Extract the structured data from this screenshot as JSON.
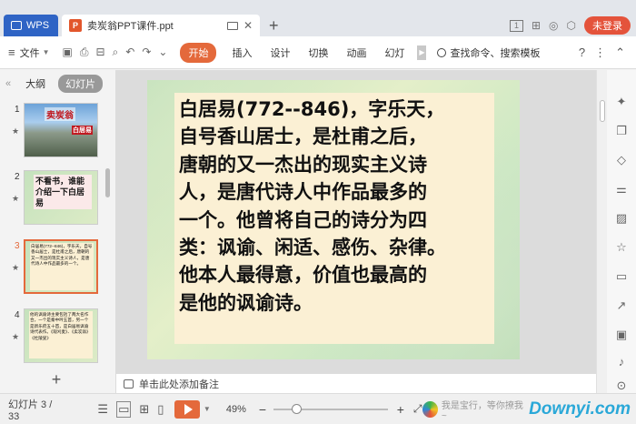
{
  "titlebar": {
    "app_tab": "WPS",
    "doc_tab": "卖炭翁PPT课件.ppt",
    "badge_num": "1",
    "login_label": "未登录"
  },
  "menubar": {
    "file_label": "文件",
    "tabs": [
      "开始",
      "插入",
      "设计",
      "切换",
      "动画",
      "幻灯"
    ],
    "search_label": "查找命令、搜索模板",
    "help_label": "?"
  },
  "left_panel": {
    "outline_tab": "大纲",
    "slides_tab": "幻灯片",
    "thumbnails": [
      {
        "num": "1",
        "title": "卖炭翁",
        "subtitle": "白居易"
      },
      {
        "num": "2",
        "text": "不看书，谁能介绍一下白居易"
      },
      {
        "num": "3",
        "text": "白居易(772--846)，字乐天，自号香山居士，是杜甫之后，唐朝的又一杰出的现实主义诗人，是唐代诗人中作品最多的一个。"
      },
      {
        "num": "4",
        "text": "他的讽谕诗主要包括了两大名作合，一个是秦中吟五首，另一个是新乐府五十首，是白居易讽谕诗代表作。《观刈麦》、《卖炭翁》《杜陵叟》"
      }
    ]
  },
  "slide": {
    "lines": [
      "白居易(772--846)，字乐天，",
      "自号香山居士，是杜甫之后，",
      "唐朝的又一杰出的现实主义诗",
      "人，是唐代诗人中作品最多的",
      "一个。他曾将自己的诗分为四",
      "类：讽谕、闲适、感伤、杂律。",
      "他本人最得意，价值也最高的",
      "是他的讽谕诗。"
    ]
  },
  "notes": {
    "placeholder": "单击此处添加备注"
  },
  "statusbar": {
    "page_info": "幻灯片 3 / 33",
    "zoom": "49%",
    "zoom_level": 0.2,
    "brand_text": "我是宝行，等你撩我~",
    "brand_logo": "Downyi.com"
  },
  "colors": {
    "accent": "#e4693b",
    "wps_blue": "#2f64c5",
    "login_red": "#e4533b"
  }
}
